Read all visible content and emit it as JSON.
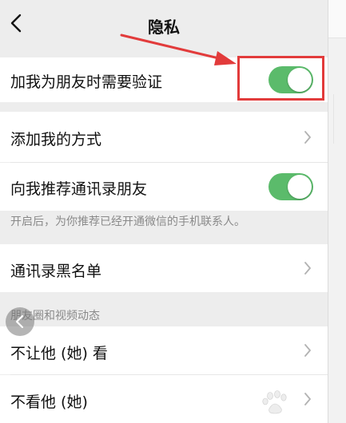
{
  "nav": {
    "title": "隐私"
  },
  "rows": {
    "verify_friend": {
      "label": "加我为朋友时需要验证",
      "enabled": true
    },
    "add_methods": {
      "label": "添加我的方式"
    },
    "recommend_contacts": {
      "label": "向我推荐通讯录朋友",
      "enabled": true
    },
    "recommend_note": "开启后，为你推荐已经开通微信的手机联系人。",
    "blacklist": {
      "label": "通讯录黑名单"
    }
  },
  "moments_section": {
    "header": "朋友圈和视频动态",
    "dont_let_see": "不让他 (她) 看",
    "dont_see": "不看他 (她)"
  },
  "colors": {
    "toggle_on": "#5bbb6b",
    "annotation_red": "#e23b3b",
    "background": "#ededed"
  },
  "icons": {
    "back": "chevron-left-icon",
    "row_arrow": "chevron-right-icon"
  }
}
